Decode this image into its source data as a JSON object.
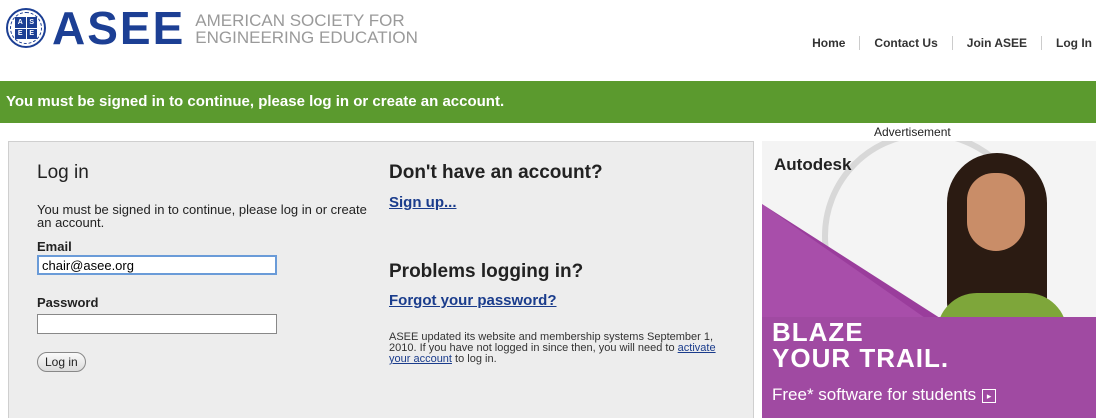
{
  "header": {
    "brand": "ASEE",
    "brand_sub_line1": "AMERICAN SOCIETY FOR",
    "brand_sub_line2": "ENGINEERING EDUCATION",
    "nav": [
      "Home",
      "Contact Us",
      "Join ASEE",
      "Log In"
    ]
  },
  "banner": {
    "message": "You must be signed in to continue, please log in or create an account."
  },
  "login": {
    "title": "Log in",
    "intro": "You must be signed in to continue, please log in or create an account.",
    "email_label": "Email",
    "email_value": "chair@asee.org",
    "password_label": "Password",
    "password_value": "",
    "submit_label": "Log in"
  },
  "signup": {
    "title": "Don't have an account?",
    "link": "Sign up..."
  },
  "problems": {
    "title": "Problems logging in?",
    "link": "Forgot your password?",
    "note_before": "ASEE updated its website and membership systems September 1, 2010. If you have not logged in since then, you will need to ",
    "note_link": "activate your account",
    "note_after": " to log in."
  },
  "ad": {
    "label": "Advertisement",
    "brand": "Autodesk",
    "headline1": "BLAZE",
    "headline2": "YOUR TRAIL.",
    "tagline": "Free* software for students",
    "colors": {
      "purple": "#a04aa2",
      "banner_green": "#5b9a2e",
      "brand_blue": "#1c3f94"
    }
  }
}
